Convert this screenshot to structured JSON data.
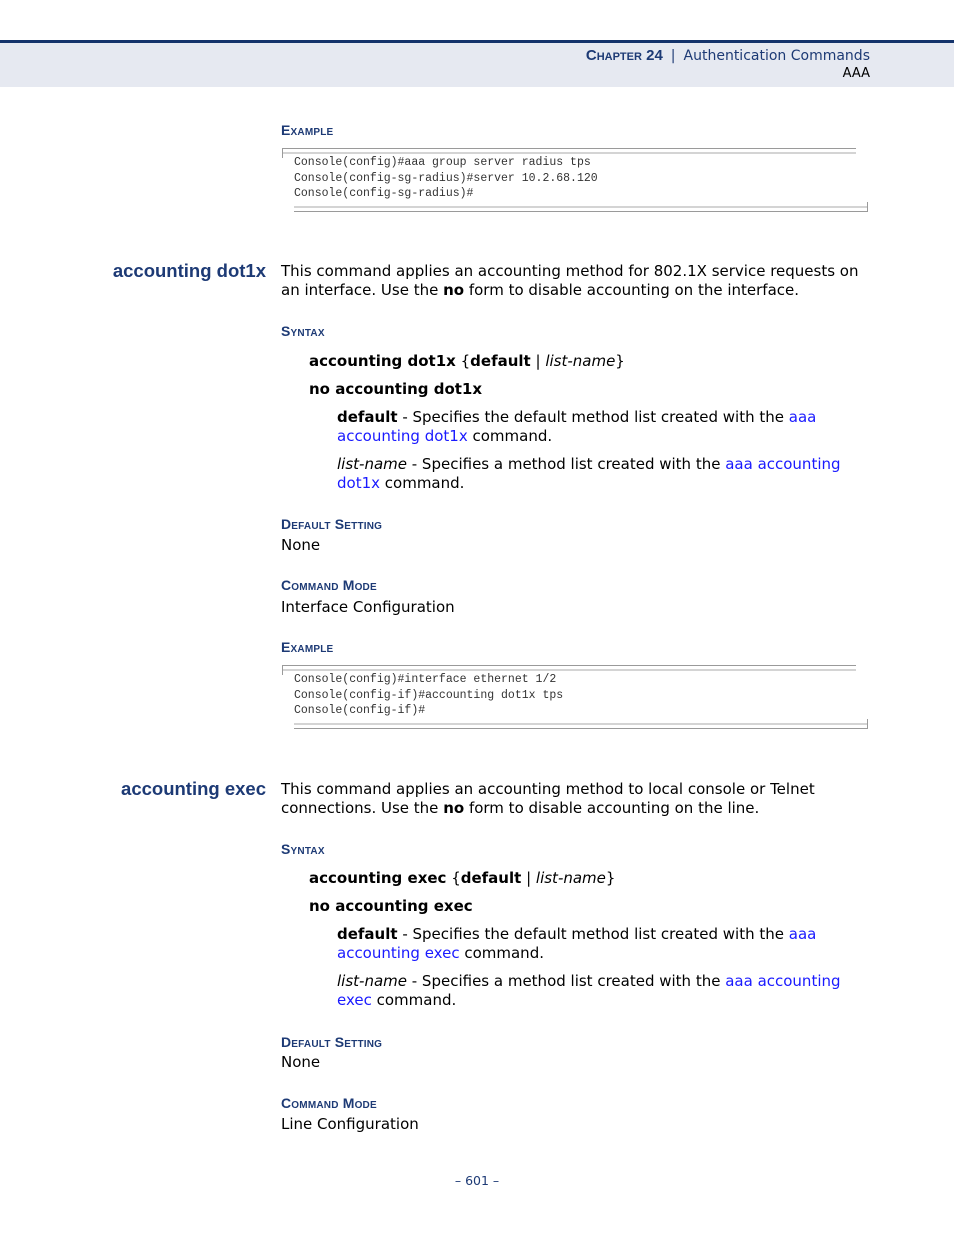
{
  "header": {
    "chapter": "Chapter 24",
    "separator": "|",
    "chapter_title": "Authentication Commands",
    "section": "AAA"
  },
  "top_example": {
    "heading": "Example",
    "code": [
      "Console(config)#aaa group server radius tps",
      "Console(config-sg-radius)#server 10.2.68.120",
      "Console(config-sg-radius)#"
    ]
  },
  "commands": [
    {
      "title": "accounting dot1x",
      "description": {
        "part1": "This command applies an accounting method for 802.1X service requests on an interface. Use the ",
        "bold": "no",
        "part2": " form to disable accounting on the interface."
      },
      "syntax_heading": "Syntax",
      "syntax": {
        "command": "accounting dot1x",
        "open_brace": " {",
        "opt1": "default",
        "pipe": " | ",
        "opt2": "list-name",
        "close_brace": "}",
        "no_form": "no accounting dot1x"
      },
      "params": [
        {
          "name": "default",
          "text": " - Specifies the default method list created with the ",
          "link": "aaa accounting dot1x",
          "suffix": " command."
        },
        {
          "name": "list-name",
          "text": " - Specifies a method list created with the ",
          "link": "aaa accounting dot1x",
          "suffix": " command."
        }
      ],
      "default_heading": "Default Setting",
      "default_value": "None",
      "mode_heading": "Command Mode",
      "mode_value": "Interface Configuration",
      "example_heading": "Example",
      "example_code": [
        "Console(config)#interface ethernet 1/2",
        "Console(config-if)#accounting dot1x tps",
        "Console(config-if)#"
      ]
    },
    {
      "title": "accounting exec",
      "description": {
        "part1": "This command applies an accounting method to local console or Telnet connections. Use the ",
        "bold": "no",
        "part2": " form to disable accounting on the line."
      },
      "syntax_heading": "Syntax",
      "syntax": {
        "command": "accounting exec",
        "open_brace": " {",
        "opt1": "default",
        "pipe": " | ",
        "opt2": "list-name",
        "close_brace": "}",
        "no_form": "no accounting exec"
      },
      "params": [
        {
          "name": "default",
          "text": " - Specifies the default method list created with the ",
          "link": "aaa accounting exec",
          "suffix": " command."
        },
        {
          "name": "list-name",
          "text": " - Specifies a method list created with the ",
          "link": "aaa accounting exec",
          "suffix": " command."
        }
      ],
      "default_heading": "Default Setting",
      "default_value": "None",
      "mode_heading": "Command Mode",
      "mode_value": "Line Configuration"
    }
  ],
  "footer": {
    "page_number": "–  601  –"
  }
}
